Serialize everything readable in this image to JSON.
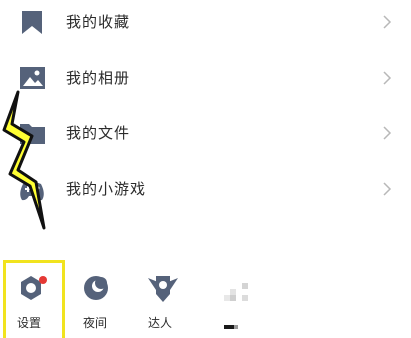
{
  "menu": {
    "items": [
      {
        "label": "我的收藏",
        "icon": "bookmark-icon"
      },
      {
        "label": "我的相册",
        "icon": "image-icon"
      },
      {
        "label": "我的文件",
        "icon": "folder-icon"
      },
      {
        "label": "我的小游戏",
        "icon": "game-controller-icon"
      }
    ]
  },
  "bottom": {
    "settings_label": "设置",
    "night_label": "夜间",
    "expert_label": "达人"
  },
  "colors": {
    "icon_gray": "#55627a",
    "notification_red": "#e53935",
    "highlight_yellow": "#f1e31e",
    "lightning_fill": "#ffff33"
  }
}
